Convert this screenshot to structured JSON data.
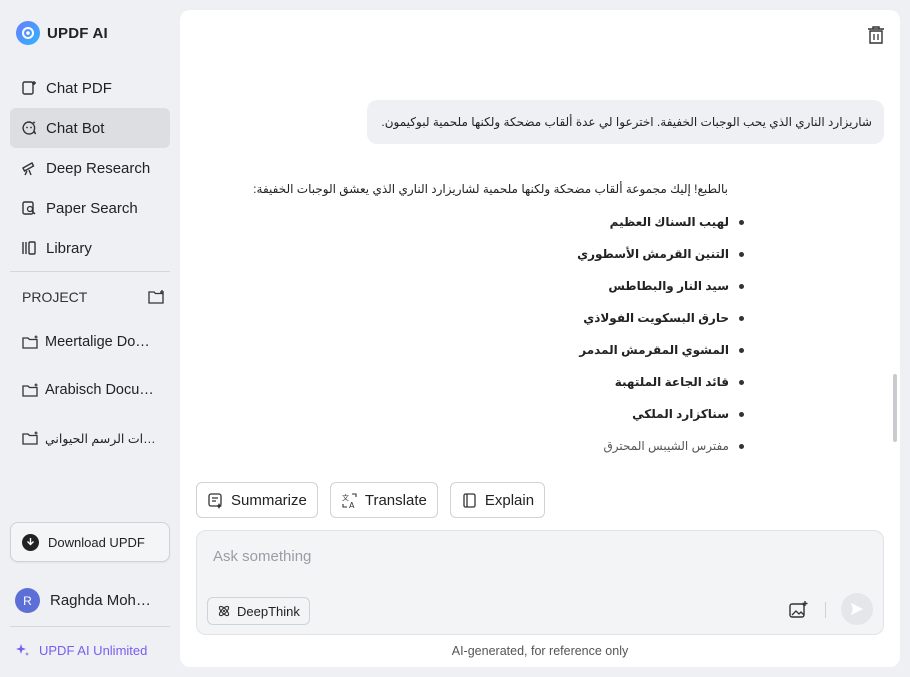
{
  "app": {
    "name": "UPDF AI"
  },
  "sidebar": {
    "items": [
      {
        "label": "Chat PDF",
        "icon": "chat-pdf-icon",
        "active": false
      },
      {
        "label": "Chat Bot",
        "icon": "chat-bot-icon",
        "active": true
      },
      {
        "label": "Deep Research",
        "icon": "deep-research-icon",
        "active": false
      },
      {
        "label": "Paper Search",
        "icon": "paper-search-icon",
        "active": false
      },
      {
        "label": "Library",
        "icon": "library-icon",
        "active": false
      }
    ],
    "project_label": "PROJECT",
    "projects": [
      {
        "label": "Meertalige Documente"
      },
      {
        "label": "Arabisch Documenten"
      },
      {
        "label": "مهارات الرسم الحيواني"
      }
    ],
    "download_label": "Download UPDF",
    "user": {
      "initial": "R",
      "name": "Raghda Mohmmed"
    },
    "plan_label": "UPDF AI Unlimited"
  },
  "chat": {
    "user_message": "شاريزارد الناري الذي يحب الوجبات الخفيفة. اخترعوا لي عدة ألقاب مضحكة ولكنها ملحمية لبوكيمون.",
    "answer_intro": "بالطبع! إليك مجموعة ألقاب مضحكة ولكنها ملحمية لشاريزارد الناري الذي يعشق الوجبات الخفيفة:",
    "answer_items": [
      "لهيب السناك العظيم",
      "التنين القرمش الأسطوري",
      "سيد النار والبطاطس",
      "حارق البسكويت الفولاذي",
      "المشوي المقرمش المدمر",
      "قائد الجاعة الملتهبة",
      "سناكزارد الملكي",
      "مفترس الشيبس المحترق"
    ]
  },
  "actions": [
    {
      "label": "Summarize",
      "icon": "summarize-icon"
    },
    {
      "label": "Translate",
      "icon": "translate-icon"
    },
    {
      "label": "Explain",
      "icon": "explain-icon"
    }
  ],
  "composer": {
    "placeholder": "Ask something",
    "value": "",
    "deepthink_label": "DeepThink"
  },
  "footer_note": "AI-generated, for reference only",
  "colors": {
    "accent": "#7a5cf0",
    "active_bg": "#dcdee2",
    "panel_bg": "#ffffff",
    "app_bg": "#eef0f3"
  }
}
